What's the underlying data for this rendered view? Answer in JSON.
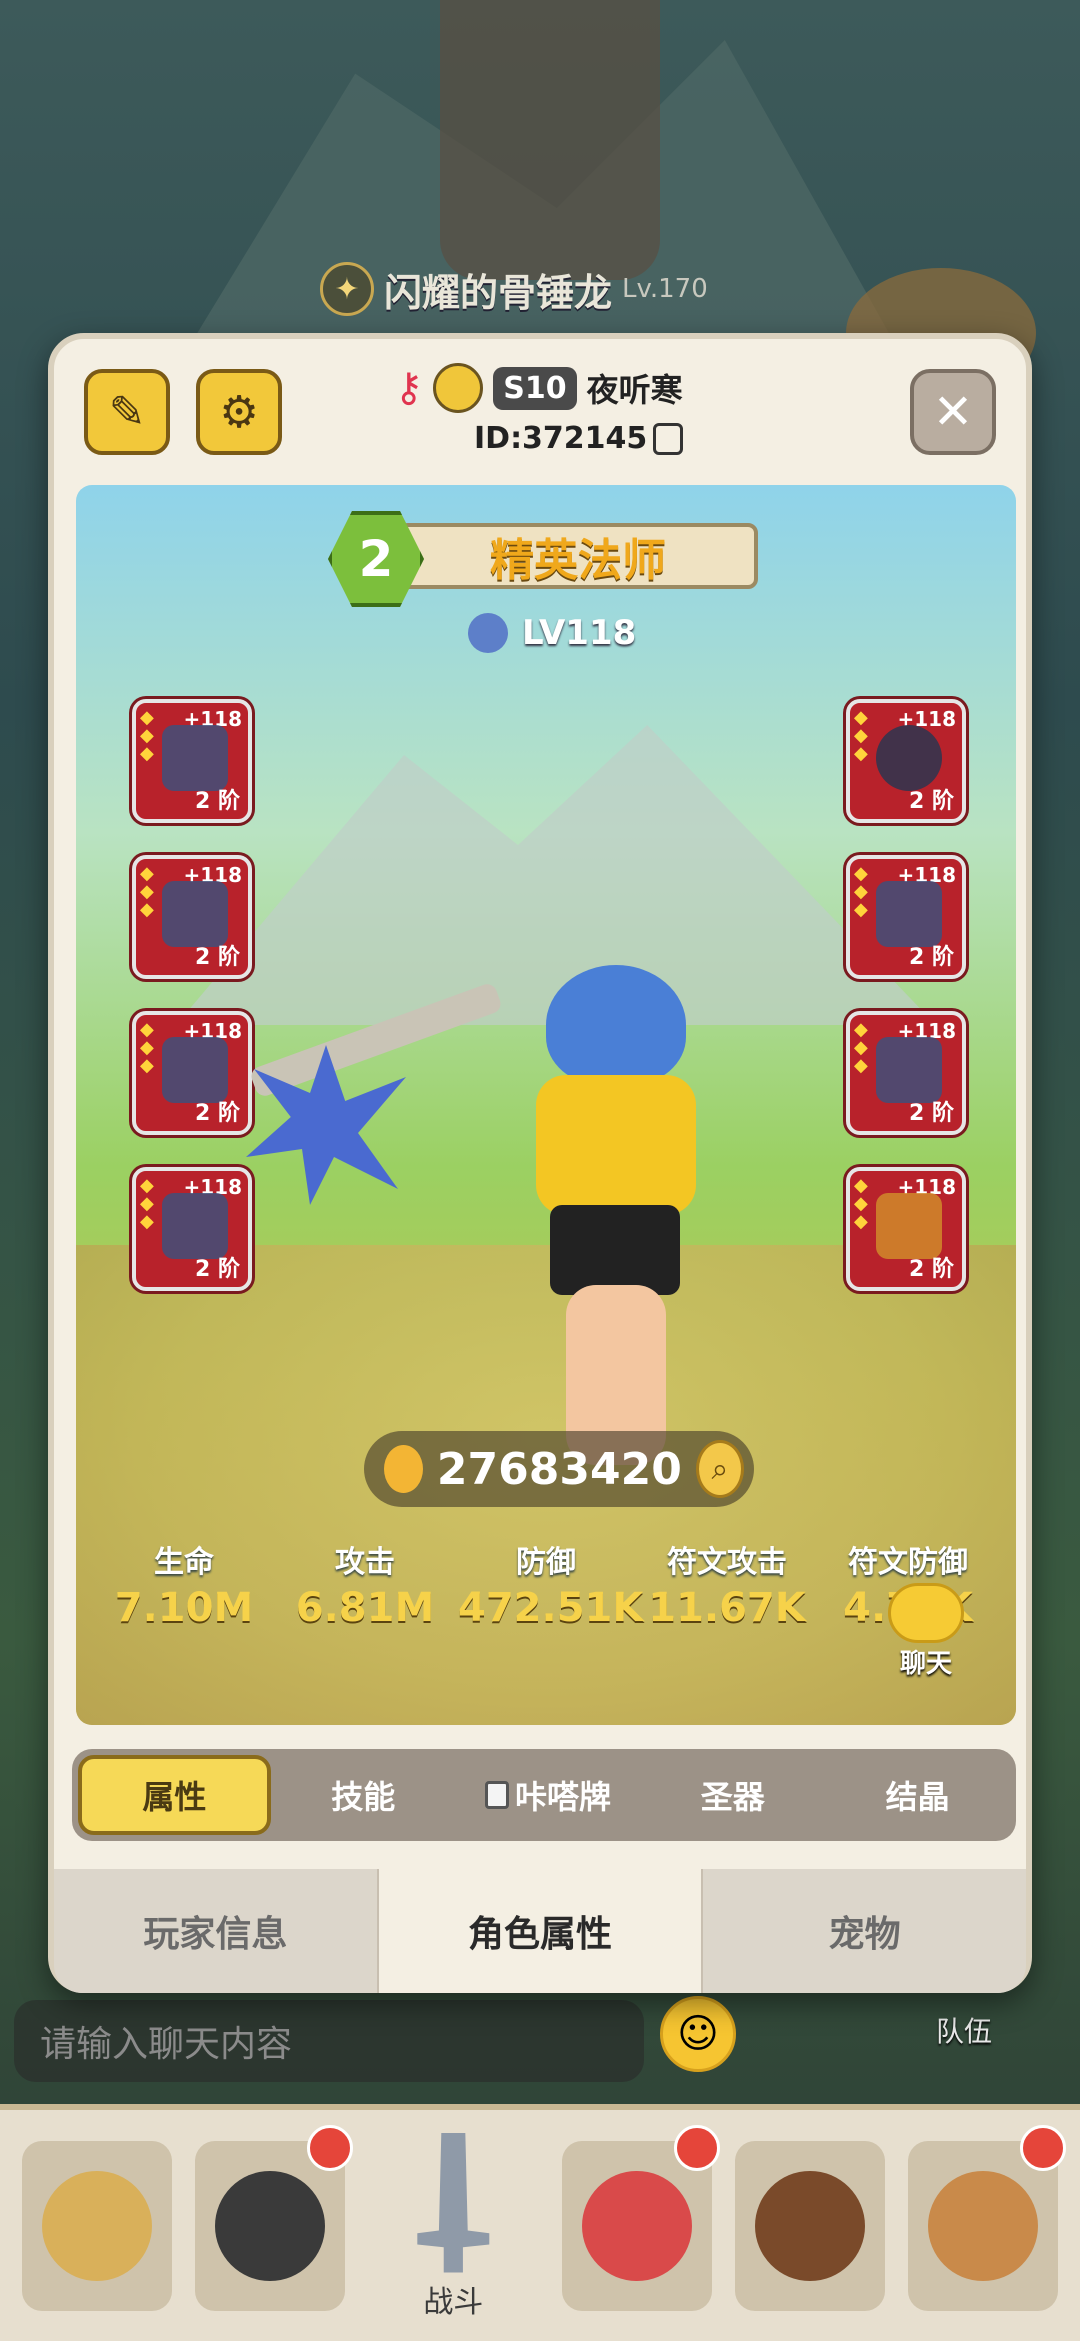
{
  "background": {
    "boss_name": "闪耀的骨锤龙",
    "boss_level": "Lv.170",
    "team_label": "队伍",
    "chat_placeholder": "请输入聊天内容",
    "battle_label": "战斗"
  },
  "header": {
    "season": "S10",
    "player_name": "夜听寒",
    "player_id": "ID:372145"
  },
  "character": {
    "rank": "2",
    "class_name": "精英法师",
    "level": "LV118",
    "power": "27683420"
  },
  "gear_left": [
    {
      "plus": "+118",
      "tier": "2 阶"
    },
    {
      "plus": "+118",
      "tier": "2 阶"
    },
    {
      "plus": "+118",
      "tier": "2 阶"
    },
    {
      "plus": "+118",
      "tier": "2 阶"
    }
  ],
  "gear_right": [
    {
      "plus": "+118",
      "tier": "2 阶"
    },
    {
      "plus": "+118",
      "tier": "2 阶"
    },
    {
      "plus": "+118",
      "tier": "2 阶"
    },
    {
      "plus": "+118",
      "tier": "2 阶"
    }
  ],
  "stats": [
    {
      "label": "生命",
      "value": "7.10M"
    },
    {
      "label": "攻击",
      "value": "6.81M"
    },
    {
      "label": "防御",
      "value": "472.51K"
    },
    {
      "label": "符文攻击",
      "value": "11.67K"
    },
    {
      "label": "符文防御",
      "value": "4.73K"
    }
  ],
  "chat_float_label": "聊天",
  "sub_tabs": [
    "属性",
    "技能",
    "咔嗒牌",
    "圣器",
    "结晶"
  ],
  "main_tabs": [
    "玩家信息",
    "角色属性",
    "宠物"
  ],
  "colors": {
    "accent": "#f6d957",
    "gear_bg": "#b8222b",
    "stat_value": "#f6d24a"
  }
}
